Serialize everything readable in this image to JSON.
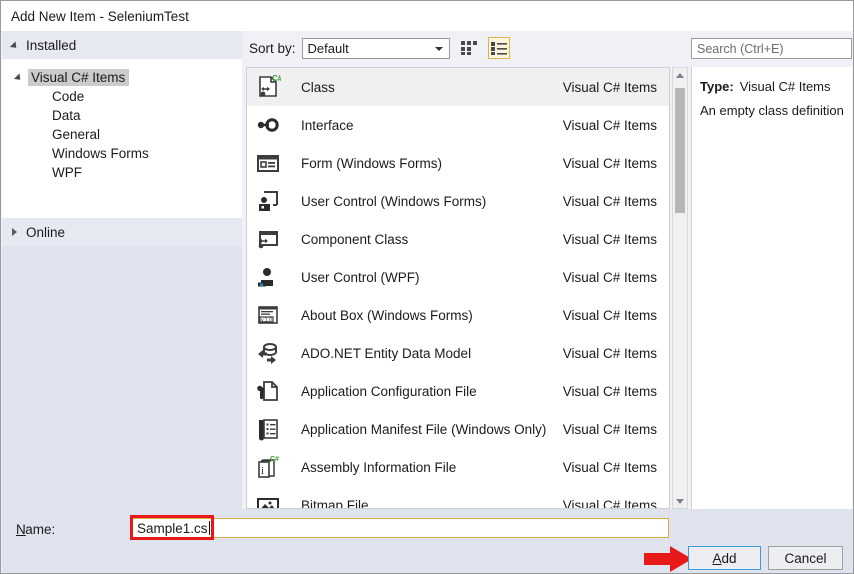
{
  "window": {
    "title": "Add New Item - SeleniumTest"
  },
  "tree": {
    "installed_header": "Installed",
    "online_header": "Online",
    "root_node": "Visual C# Items",
    "children": [
      "Code",
      "Data",
      "General",
      "Windows Forms",
      "WPF"
    ]
  },
  "toolbar": {
    "sort_by_label": "Sort by:",
    "sort_value": "Default",
    "sort_options": [
      "Default"
    ],
    "grid_view_icon": "grid-view-icon",
    "list_view_icon": "list-view-icon"
  },
  "search": {
    "placeholder": "Search (Ctrl+E)"
  },
  "list": {
    "items": [
      {
        "name": "Class",
        "category": "Visual C# Items",
        "icon": "class-file-icon",
        "selected": true
      },
      {
        "name": "Interface",
        "category": "Visual C# Items",
        "icon": "interface-icon",
        "selected": false
      },
      {
        "name": "Form (Windows Forms)",
        "category": "Visual C# Items",
        "icon": "form-icon",
        "selected": false
      },
      {
        "name": "User Control (Windows Forms)",
        "category": "Visual C# Items",
        "icon": "user-control-icon",
        "selected": false
      },
      {
        "name": "Component Class",
        "category": "Visual C# Items",
        "icon": "component-class-icon",
        "selected": false
      },
      {
        "name": "User Control (WPF)",
        "category": "Visual C# Items",
        "icon": "user-control-wpf-icon",
        "selected": false
      },
      {
        "name": "About Box (Windows Forms)",
        "category": "Visual C# Items",
        "icon": "about-box-icon",
        "selected": false
      },
      {
        "name": "ADO.NET Entity Data Model",
        "category": "Visual C# Items",
        "icon": "ado-net-entity-icon",
        "selected": false
      },
      {
        "name": "Application Configuration File",
        "category": "Visual C# Items",
        "icon": "app-config-icon",
        "selected": false
      },
      {
        "name": "Application Manifest File (Windows Only)",
        "category": "Visual C# Items",
        "icon": "app-manifest-icon",
        "selected": false
      },
      {
        "name": "Assembly Information File",
        "category": "Visual C# Items",
        "icon": "assembly-info-icon",
        "selected": false
      },
      {
        "name": "Bitmap File",
        "category": "Visual C# Items",
        "icon": "bitmap-file-icon",
        "selected": false
      }
    ]
  },
  "info": {
    "type_label": "Type:",
    "type_value": "Visual C# Items",
    "description": "An empty class definition"
  },
  "footer": {
    "name_label_prefix": "",
    "name_label": "Name:",
    "name_value": "Sample1.cs",
    "add_label": "Add",
    "cancel_label": "Cancel"
  },
  "colors": {
    "accent_blue": "#3f9bdc",
    "annotation_red": "#e81919",
    "focus_gold": "#e0aa3e",
    "panel_blue_gray": "#dfe3ee",
    "csharp_green": "#3a9b35"
  }
}
